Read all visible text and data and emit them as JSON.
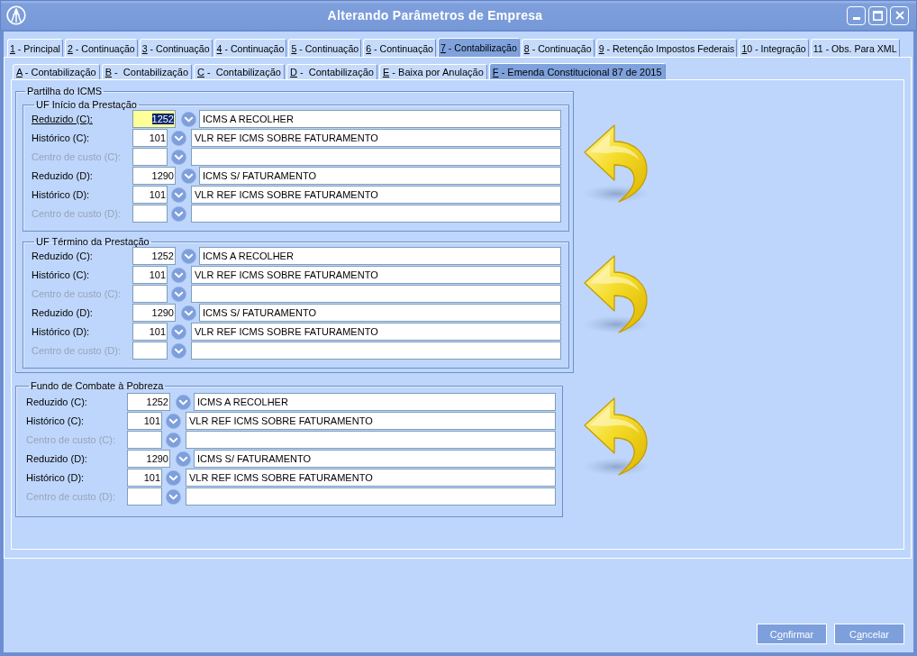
{
  "window": {
    "title": "Alterando Parâmetros de Empresa"
  },
  "tabs": [
    {
      "key": "1",
      "after": " - Principal",
      "selected": false
    },
    {
      "key": "2",
      "after": " - Continuação",
      "selected": false
    },
    {
      "key": "3",
      "after": " - Continuação",
      "selected": false
    },
    {
      "key": "4",
      "after": " - Continuação",
      "selected": false
    },
    {
      "key": "5",
      "after": " - Continuação",
      "selected": false
    },
    {
      "key": "6",
      "after": " - Continuação",
      "selected": false
    },
    {
      "key": "7",
      "after": " - Contabilização",
      "selected": true
    },
    {
      "key": "8",
      "after": " - Continuação",
      "selected": false
    },
    {
      "key": "9",
      "after": " - Retenção Impostos Federais",
      "selected": false
    },
    {
      "key": "1",
      "after": "0 - Integração",
      "selected": false
    },
    {
      "after": "11 - Obs. Para XML",
      "selected": false
    }
  ],
  "subtabs": [
    {
      "key": "A",
      "after": " - Contabilização",
      "selected": false
    },
    {
      "key": "B",
      "after": " -  Contabilização",
      "selected": false
    },
    {
      "key": "C",
      "after": " -  Contabilização",
      "selected": false
    },
    {
      "key": "D",
      "after": " -  Contabilização",
      "selected": false
    },
    {
      "key": "E",
      "after": " - Baixa por Anulação",
      "selected": false
    },
    {
      "key": "F",
      "after": " - Emenda Constitucional 87 de 2015",
      "selected": true
    }
  ],
  "groups": [
    {
      "title": "Partilha do ICMS",
      "subgroups": [
        {
          "title": "UF Início da Prestação",
          "rows": [
            {
              "kind": "account",
              "label": "Reduzido (C):",
              "code": "1252",
              "description": "ICMS A RECOLHER",
              "disabled": false,
              "focused": true
            },
            {
              "kind": "history",
              "label": "Histórico (C):",
              "code": "101",
              "description": "VLR REF ICMS SOBRE FATURAMENTO",
              "disabled": false,
              "focused": false
            },
            {
              "kind": "cost_center",
              "label": "Centro de custo (C):",
              "disabled": true,
              "focused": false
            },
            {
              "kind": "account",
              "label": "Reduzido (D):",
              "code": "1290",
              "description": "ICMS S/ FATURAMENTO",
              "disabled": false,
              "focused": false
            },
            {
              "kind": "history",
              "label": "Histórico (D):",
              "code": "101",
              "description": "VLR REF ICMS SOBRE FATURAMENTO",
              "disabled": false,
              "focused": false
            },
            {
              "kind": "cost_center",
              "label": "Centro de custo (D):",
              "disabled": true,
              "focused": false
            }
          ]
        },
        {
          "title": "UF Término da Prestação",
          "rows": [
            {
              "kind": "account",
              "label": "Reduzido (C):",
              "code": "1252",
              "description": "ICMS A RECOLHER",
              "disabled": false,
              "focused": false
            },
            {
              "kind": "history",
              "label": "Histórico (C):",
              "code": "101",
              "description": "VLR REF ICMS SOBRE FATURAMENTO",
              "disabled": false,
              "focused": false
            },
            {
              "kind": "cost_center",
              "label": "Centro de custo (C):",
              "disabled": true,
              "focused": false
            },
            {
              "kind": "account",
              "label": "Reduzido (D):",
              "code": "1290",
              "description": "ICMS S/ FATURAMENTO",
              "disabled": false,
              "focused": false
            },
            {
              "kind": "history",
              "label": "Histórico (D):",
              "code": "101",
              "description": "VLR REF ICMS SOBRE FATURAMENTO",
              "disabled": false,
              "focused": false
            },
            {
              "kind": "cost_center",
              "label": "Centro de custo (D):",
              "disabled": true,
              "focused": false
            }
          ]
        }
      ]
    },
    {
      "title": "Fundo de Combate à Pobreza",
      "rows": [
        {
          "kind": "account",
          "label": "Reduzido (C):",
          "code": "1252",
          "description": "ICMS A RECOLHER",
          "disabled": false,
          "focused": false
        },
        {
          "kind": "history",
          "label": "Histórico (C):",
          "code": "101",
          "description": "VLR REF ICMS SOBRE FATURAMENTO",
          "disabled": false,
          "focused": false
        },
        {
          "kind": "cost_center",
          "label": "Centro de custo (C):",
          "disabled": true,
          "focused": false
        },
        {
          "kind": "account",
          "label": "Reduzido (D):",
          "code": "1290",
          "description": "ICMS S/ FATURAMENTO",
          "disabled": false,
          "focused": false
        },
        {
          "kind": "history",
          "label": "Histórico (D):",
          "code": "101",
          "description": "VLR REF ICMS SOBRE FATURAMENTO",
          "disabled": false,
          "focused": false
        },
        {
          "kind": "cost_center",
          "label": "Centro de custo (D):",
          "disabled": true,
          "focused": false
        }
      ]
    }
  ],
  "buttons": [
    {
      "before": "C",
      "key": "o",
      "after": "nfirmar"
    },
    {
      "before": "C",
      "key": "a",
      "after": "ncelar"
    }
  ]
}
